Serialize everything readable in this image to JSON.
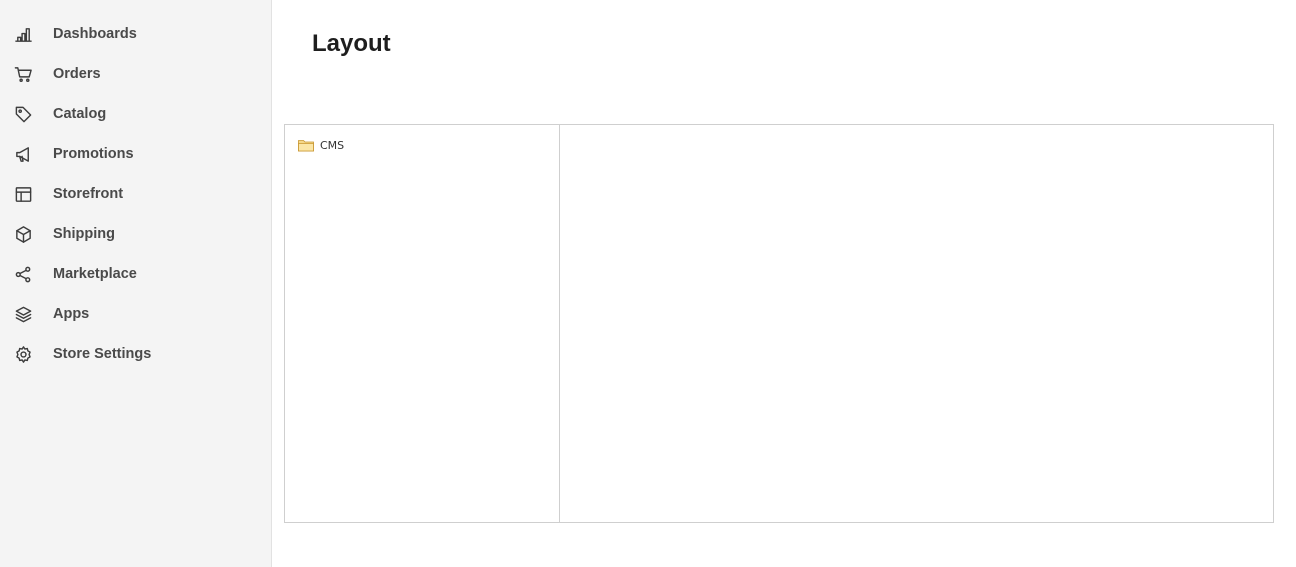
{
  "sidebar": {
    "items": [
      {
        "label": "Dashboards",
        "icon": "bar-chart-icon"
      },
      {
        "label": "Orders",
        "icon": "cart-icon"
      },
      {
        "label": "Catalog",
        "icon": "tag-icon"
      },
      {
        "label": "Promotions",
        "icon": "megaphone-icon"
      },
      {
        "label": "Storefront",
        "icon": "layout-icon"
      },
      {
        "label": "Shipping",
        "icon": "box-icon"
      },
      {
        "label": "Marketplace",
        "icon": "share-icon"
      },
      {
        "label": "Apps",
        "icon": "layers-icon"
      },
      {
        "label": "Store Settings",
        "icon": "gear-icon"
      }
    ]
  },
  "main": {
    "title": "Layout",
    "tree": {
      "nodes": [
        {
          "label": "CMS",
          "icon": "folder-icon"
        }
      ]
    }
  },
  "colors": {
    "sidebar_bg": "#f4f4f4",
    "border": "#cfcfcf",
    "folder": "#e8b64c"
  }
}
